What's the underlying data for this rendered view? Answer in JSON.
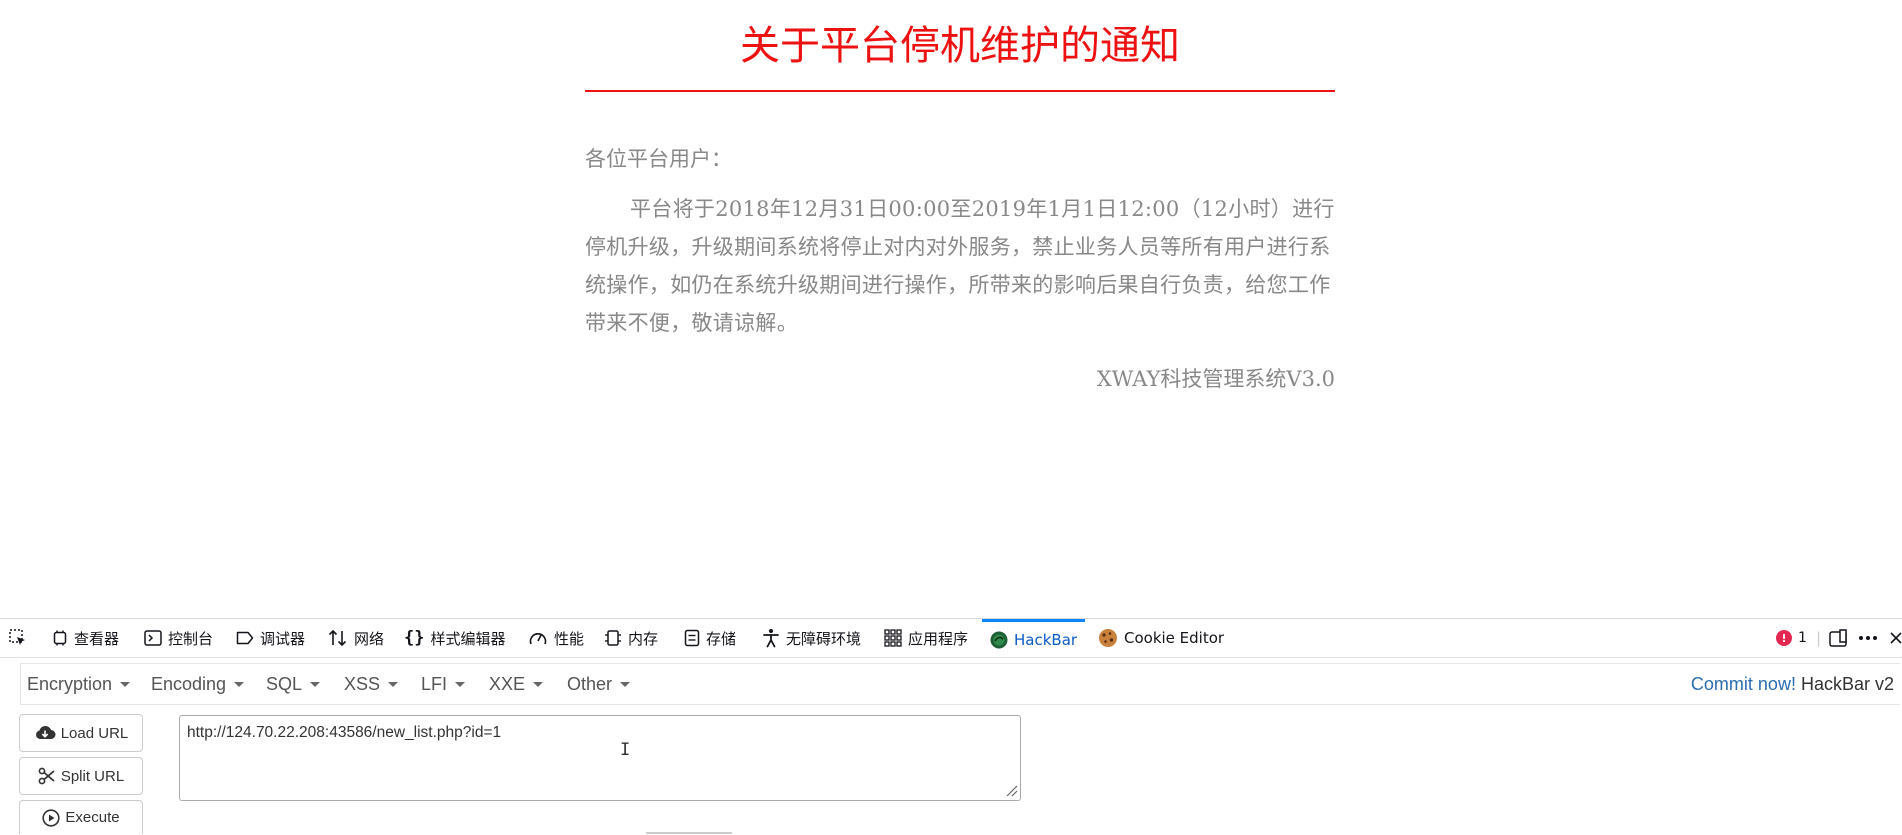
{
  "notice": {
    "title": "关于平台停机维护的通知",
    "greeting": "各位平台用户：",
    "body": "平台将于2018年12月31日00:00至2019年1月1日12:00（12小时）进行停机升级，升级期间系统将停止对内对外服务，禁止业务人员等所有用户进行系统操作，如仍在系统升级期间进行操作，所带来的影响后果自行负责，给您工作带来不便，敬请谅解。",
    "signature": "XWAY科技管理系统V3.0"
  },
  "devtools": {
    "tabs": [
      {
        "label": "查看器",
        "icon": "inspector-icon"
      },
      {
        "label": "控制台",
        "icon": "console-icon"
      },
      {
        "label": "调试器",
        "icon": "debugger-icon"
      },
      {
        "label": "网络",
        "icon": "network-icon"
      },
      {
        "label": "样式编辑器",
        "icon": "style-editor-icon"
      },
      {
        "label": "性能",
        "icon": "performance-icon"
      },
      {
        "label": "内存",
        "icon": "memory-icon"
      },
      {
        "label": "存储",
        "icon": "storage-icon"
      },
      {
        "label": "无障碍环境",
        "icon": "accessibility-icon"
      },
      {
        "label": "应用程序",
        "icon": "application-icon"
      },
      {
        "label": "HackBar",
        "icon": "hackbar-icon",
        "active": true
      },
      {
        "label": "Cookie Editor",
        "icon": "cookie-icon"
      }
    ],
    "error_count": "1",
    "accent_color": "#0a84ff"
  },
  "hackbar": {
    "menu": [
      "Encryption",
      "Encoding",
      "SQL",
      "XSS",
      "LFI",
      "XXE",
      "Other"
    ],
    "commit_label": "Commit now!",
    "version_label": "HackBar v2",
    "load_url_label": "Load URL",
    "split_url_label": "Split URL",
    "execute_label": "Execute",
    "url_value": "http://124.70.22.208:43586/new_list.php?id=1"
  }
}
